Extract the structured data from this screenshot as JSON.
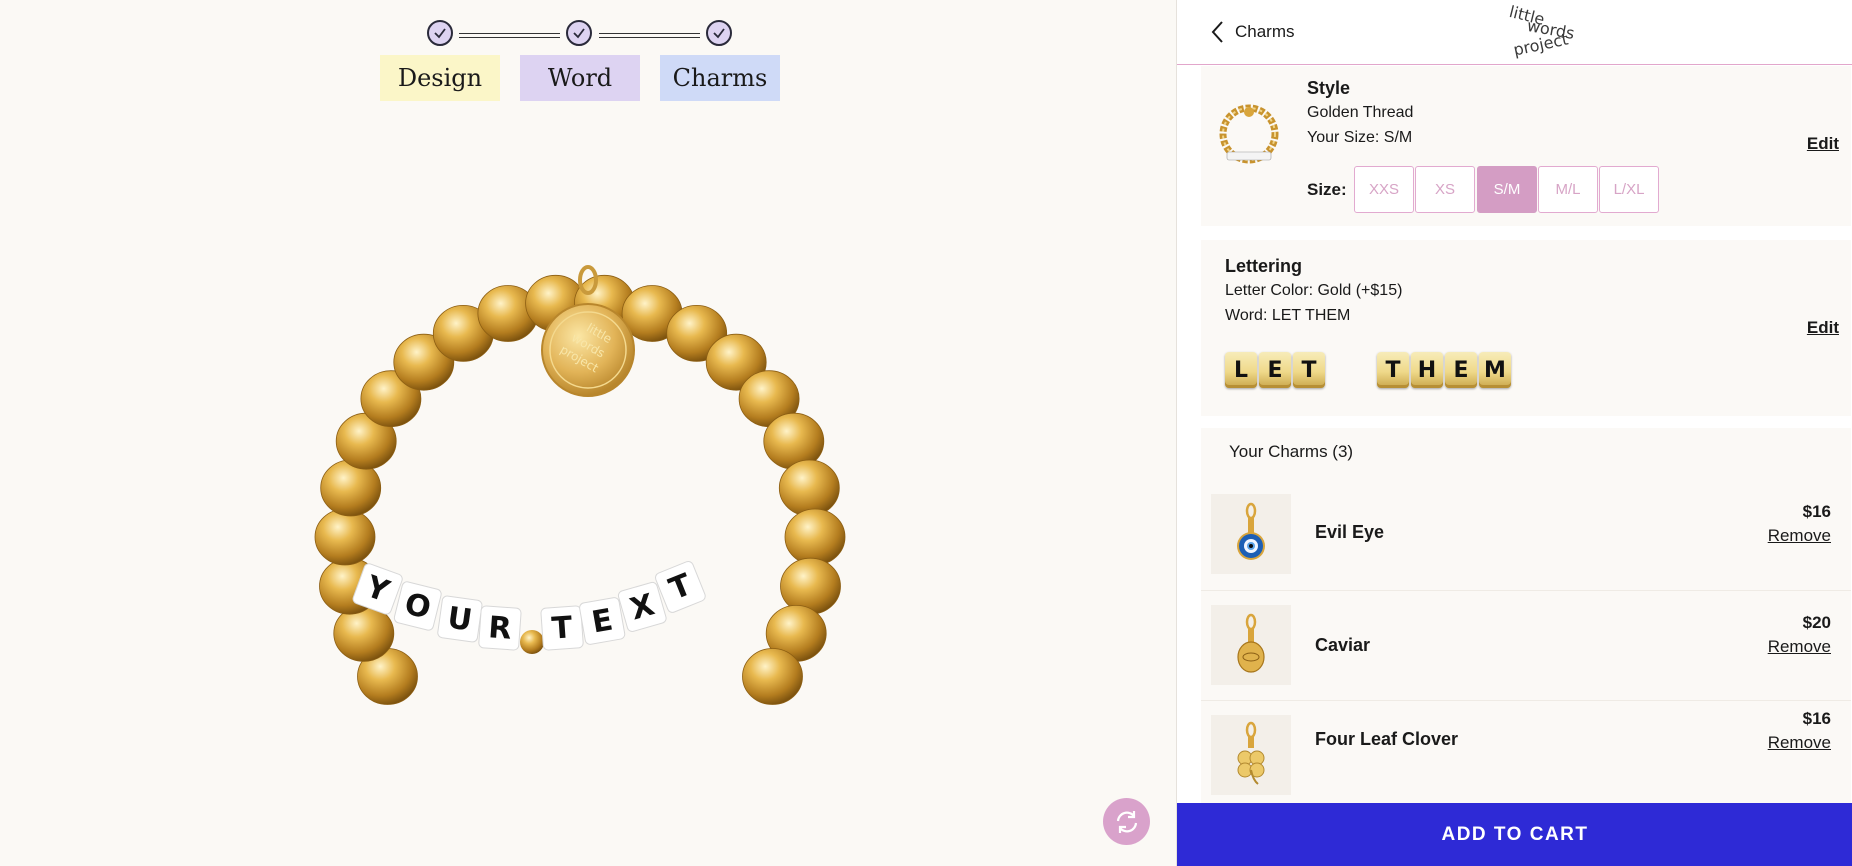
{
  "stepper": {
    "steps": [
      {
        "label": "Design",
        "completed": true
      },
      {
        "label": "Word",
        "completed": true
      },
      {
        "label": "Charms",
        "completed": true
      }
    ],
    "colors": {
      "design": "#fbf6c8",
      "word": "#ddd3f2",
      "charms": "#cfdaf7"
    }
  },
  "preview": {
    "bead_text": [
      "Y",
      "O",
      "U",
      "R",
      "T",
      "E",
      "X",
      "T"
    ],
    "tag_text": [
      "little",
      "words",
      "project"
    ],
    "refresh_icon": "refresh-icon"
  },
  "panel": {
    "back_label": "Charms",
    "logo_lines": [
      "little",
      "words",
      "project"
    ],
    "style": {
      "title": "Style",
      "design": "Golden Thread",
      "your_size": "Your Size: S/M",
      "size_label": "Size:",
      "sizes": [
        "XXS",
        "XS",
        "S/M",
        "M/L",
        "L/XL"
      ],
      "selected_size": "S/M",
      "edit": "Edit"
    },
    "lettering": {
      "title": "Lettering",
      "color": "Letter Color: Gold (+$15)",
      "word": "Word: LET THEM",
      "beads": [
        "L",
        "E",
        "T",
        "",
        "T",
        "H",
        "E",
        "M"
      ],
      "edit": "Edit"
    },
    "charms": {
      "title": "Your Charms (3)",
      "items": [
        {
          "name": "Evil Eye",
          "price": "$16",
          "remove": "Remove"
        },
        {
          "name": "Caviar",
          "price": "$20",
          "remove": "Remove"
        },
        {
          "name": "Four Leaf Clover",
          "price": "$16",
          "remove": "Remove"
        }
      ]
    },
    "add_to_cart": "ADD TO CART"
  },
  "colors": {
    "accent": "#2e2ad6",
    "pink": "#d49dc4",
    "gold": "#d9a53c"
  }
}
